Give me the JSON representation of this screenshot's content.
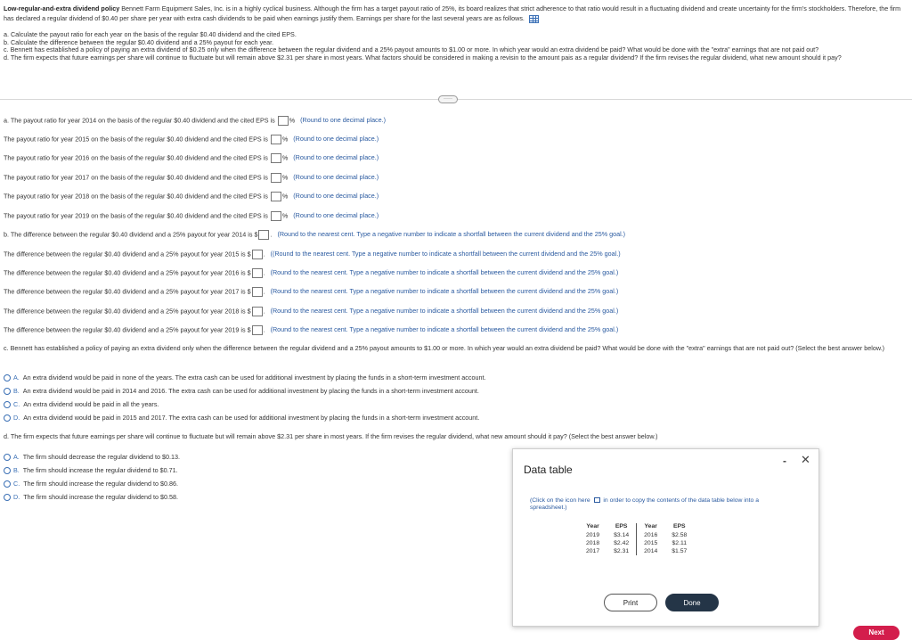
{
  "intro": {
    "title": "Low-regular-and-extra dividend policy",
    "text": "Bennett Farm Equipment Sales, Inc. is in a highly cyclical business. Although the firm has a target payout ratio of 25%, its board realizes that strict adherence to that ratio would result in a fluctuating dividend and create uncertainty for the firm's stockholders. Therefore, the firm has declared a regular dividend of $0.40 per share per year with extra cash dividends to be paid when earnings justify them. Earnings per share for the last several years are as follows."
  },
  "questions": [
    "a. Calculate the payout ratio for each year on the basis of the regular $0.40 dividend and the cited EPS.",
    "b. Calculate the difference between the regular $0.40 dividend and a 25% payout for each year.",
    "c. Bennett has established a policy of paying an extra dividend of $0.25 only when the difference between the regular dividend and a 25% payout amounts to $1.00 or more. In which year would an extra dividend be paid? What would be done with the \"extra\" earnings that are not paid out?",
    "d. The firm expects that future earnings per share will continue to fluctuate but will remain above $2.31 per share in most years. What factors should be considered in making a revisin to the amount pais as a regular dividend? If the firm revises the regular dividend, what new amount should it pay?"
  ],
  "more_label": "·····",
  "part_a": {
    "rows": [
      {
        "prefix": "a.  The payout ratio for year 2014 on the basis of the regular $0.40 dividend and the cited EPS is",
        "unit": "%",
        "hint": "(Round to one decimal place.)"
      },
      {
        "prefix": "The payout ratio for year 2015 on the basis of the regular $0.40 dividend and the cited EPS is",
        "unit": "%",
        "hint": "(Round to one decimal place.)"
      },
      {
        "prefix": "The payout ratio for year 2016 on the basis of the regular $0.40 dividend and the cited EPS is",
        "unit": "%",
        "hint": "(Round to one decimal place.)"
      },
      {
        "prefix": "The payout ratio for year 2017 on the basis of the regular $0.40 dividend and the cited EPS is",
        "unit": "%",
        "hint": "(Round to one decimal place.)"
      },
      {
        "prefix": "The payout ratio for year 2018 on the basis of the regular $0.40 dividend and the cited EPS is",
        "unit": "%",
        "hint": "(Round to one decimal place.)"
      },
      {
        "prefix": "The payout ratio for year 2019 on the basis of the regular $0.40 dividend and the cited EPS is",
        "unit": "%",
        "hint": "(Round to one decimal place.)"
      }
    ]
  },
  "part_b": {
    "rows": [
      {
        "prefix": "b.  The difference between the regular $0.40 dividend and a 25% payout for year 2014 is $",
        "suffix": ".",
        "hint": "(Round to the nearest cent. Type a negative number to indicate a shortfall between the current dividend and the 25% goal.)"
      },
      {
        "prefix": "The difference between the regular $0.40 dividend and a 25% payout for year 2015 is $",
        "suffix": ".",
        "hint": "((Round to the nearest cent. Type a negative number to indicate a shortfall between the current dividend and the 25% goal.)"
      },
      {
        "prefix": "The difference between the regular $0.40 dividend and a 25% payout for year 2016 is $",
        "suffix": ".",
        "hint": "(Round to the nearest cent. Type a negative number to indicate a shortfall between the current dividend and the 25% goal.)"
      },
      {
        "prefix": "The difference between the regular $0.40 dividend and a 25% payout for year 2017 is $",
        "suffix": ".",
        "hint": "(Round to the nearest cent. Type a negative number to indicate a shortfall between the current dividend and the 25% goal.)"
      },
      {
        "prefix": "The difference between the regular $0.40 dividend and a 25% payout for year 2018 is $",
        "suffix": ".",
        "hint": "(Round to the nearest cent. Type a negative number to indicate a shortfall between the current dividend and the 25% goal.)"
      },
      {
        "prefix": "The difference between the regular $0.40 dividend and a 25% payout for year 2019 is $",
        "suffix": ".",
        "hint": "(Round to the nearest cent. Type a negative number to indicate a shortfall between the current dividend and the 25% goal.)"
      }
    ]
  },
  "part_c": {
    "question": "c.  Bennett has established a policy of paying an extra dividend only when the difference between the regular dividend and a 25% payout amounts to $1.00 or more. In which year would an extra dividend be paid? What would be done with the \"extra\" earnings that are not paid out? (Select the best answer below.)",
    "options": [
      {
        "letter": "A.",
        "text": "An extra dividend would be paid in none of the years. The extra cash can be used for additional investment by placing the funds in a short-term investment account."
      },
      {
        "letter": "B.",
        "text": "An extra dividend would be paid in 2014 and 2016. The extra cash can be used for additional investment by placing the funds in a short-term investment account."
      },
      {
        "letter": "C.",
        "text": "An extra dividend would be paid in all the years."
      },
      {
        "letter": "D.",
        "text": "An extra dividend would be paid in 2015 and 2017. The extra cash can be used for additional investment by placing the funds in a short-term investment account."
      }
    ]
  },
  "part_d": {
    "question": "d.  The firm expects that future earnings per share will continue to fluctuate but will remain above $2.31 per share in most years. If the firm revises the regular dividend, what new amount should it pay? (Select the best answer below.)",
    "options": [
      {
        "letter": "A.",
        "text": "The firm should decrease the regular dividend to $0.13."
      },
      {
        "letter": "B.",
        "text": "The firm should increase the regular dividend to $0.71."
      },
      {
        "letter": "C.",
        "text": "The firm should increase the regular dividend to $0.86."
      },
      {
        "letter": "D.",
        "text": "The firm should increase the regular dividend to $0.58."
      }
    ]
  },
  "dialog": {
    "title": "Data table",
    "minimize": "-",
    "close": "✕",
    "note_before": "(Click on the icon here",
    "note_after": "in order to copy the contents of the data table below into a spreadsheet.)",
    "headers": [
      "Year",
      "EPS",
      "Year",
      "EPS"
    ],
    "rows": [
      [
        "2019",
        "$3.14",
        "2016",
        "$2.58"
      ],
      [
        "2018",
        "$2.42",
        "2015",
        "$2.11"
      ],
      [
        "2017",
        "$2.31",
        "2014",
        "$1.57"
      ]
    ],
    "print_label": "Print",
    "done_label": "Done"
  },
  "next_label": "Next",
  "colors": {
    "accent": "#3a6fb5",
    "next": "#d31e4c",
    "done": "#243547"
  }
}
